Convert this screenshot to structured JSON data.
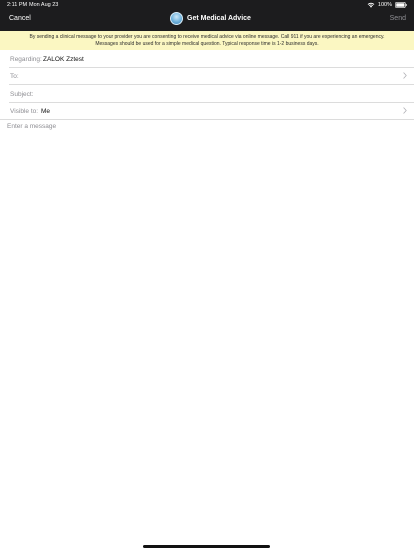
{
  "status_bar": {
    "time": "2:11 PM",
    "date": "Mon Aug 23",
    "battery_percent": "100%"
  },
  "nav": {
    "cancel_label": "Cancel",
    "title": "Get Medical Advice",
    "send_label": "Send"
  },
  "disclaimer": {
    "line1": "By sending a clinical message to your provider you are consenting to receive medical advice via online message. Call 911 if you are experiencing an emergency.",
    "line2": "Messages should be used for a simple medical question. Typical response time is 1-2 business days."
  },
  "form": {
    "regarding": {
      "label": "Regarding:",
      "value": "ZALOK Zztest"
    },
    "to": {
      "label": "To:",
      "value": ""
    },
    "subject": {
      "label": "Subject:",
      "value": ""
    },
    "visible_to": {
      "label": "Visible to:",
      "value": "Me"
    },
    "message_placeholder": "Enter a message"
  },
  "icons": {
    "wifi": "wifi-icon",
    "battery": "battery-icon",
    "chevron": "chevron-right-icon",
    "logo": "app-logo-icon"
  },
  "colors": {
    "header_bg": "#1c1c1e",
    "banner_bg": "#fbf7c2",
    "label_gray": "#8e8e93"
  }
}
